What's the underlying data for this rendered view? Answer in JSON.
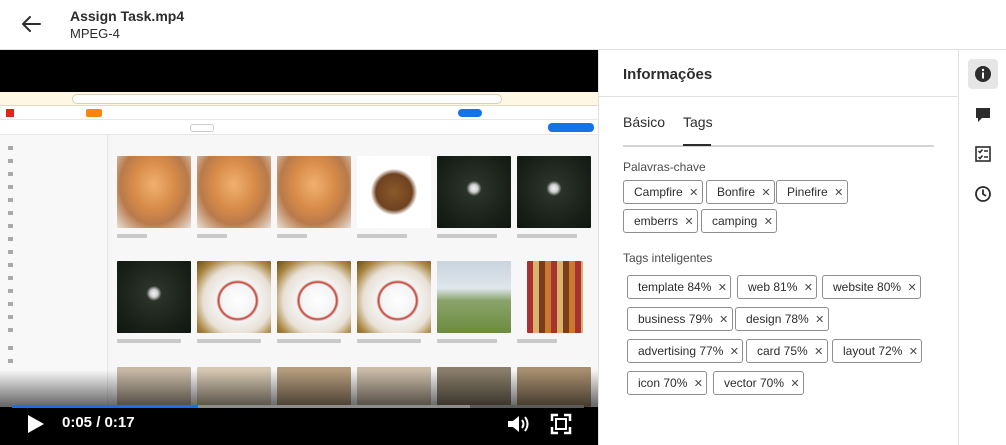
{
  "header": {
    "title": "Assign Task.mp4",
    "subtitle": "MPEG-4"
  },
  "player": {
    "time_label": "0:05 / 0:17",
    "progress": 0.325,
    "buffered": 0.8
  },
  "panel": {
    "title": "Informações",
    "tabs": [
      {
        "label": "Básico"
      },
      {
        "label": "Tags",
        "active": true
      }
    ],
    "keywords_label": "Palavras-chave",
    "keywords": [
      "Campfire",
      "Bonfire",
      "Pinefire",
      "emberrs",
      "camping"
    ],
    "smart_tags_label": "Tags inteligentes",
    "smart_tags": [
      "template 84%",
      "web 81%",
      "website 80%",
      "business 79%",
      "design 78%",
      "advertising 77%",
      "card 75%",
      "layout 72%",
      "icon 70%",
      "vector 70%"
    ],
    "remove_symbol": "✕"
  },
  "rail": {
    "items": [
      "info-icon",
      "comment-icon",
      "tasks-icon",
      "history-icon"
    ]
  },
  "colors": {
    "accent": "#1473e6",
    "text": "#2c2c2c"
  }
}
